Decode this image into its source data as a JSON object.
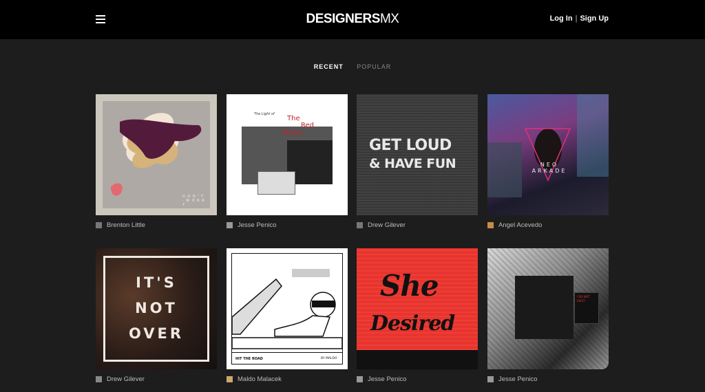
{
  "header": {
    "logo_main": "DESIGNERS",
    "logo_suffix": "MX",
    "login_label": "Log In",
    "signup_label": "Sign Up"
  },
  "tabs": [
    {
      "label": "RECENT"
    },
    {
      "label": "POPULAR"
    }
  ],
  "cards": [
    {
      "author": "Brenton Little",
      "art_text": "D O N ' T · W O R R Y"
    },
    {
      "author": "Jesse Penico",
      "art_text": "The Light of",
      "art_text2": "The",
      "art_text3": "Red",
      "art_text4": "Moon"
    },
    {
      "author": "Drew Gilever",
      "art_text": "GET LOUD",
      "art_text2": "& HAVE FUN"
    },
    {
      "author": "Angel Acevedo",
      "art_text": "NEO ARKADE"
    },
    {
      "author": "Drew Gilever",
      "art_text": "IT'S",
      "art_text2": "NOT",
      "art_text3": "OVER"
    },
    {
      "author": "Maldo Malacek",
      "art_text": "HIT THE ROAD",
      "art_text2": "BY MALDO"
    },
    {
      "author": "Jesse Penico",
      "art_text": "She",
      "art_text2": "Desired"
    },
    {
      "author": "Jesse Penico",
      "art_text": "I DO NOT EXIST"
    }
  ]
}
